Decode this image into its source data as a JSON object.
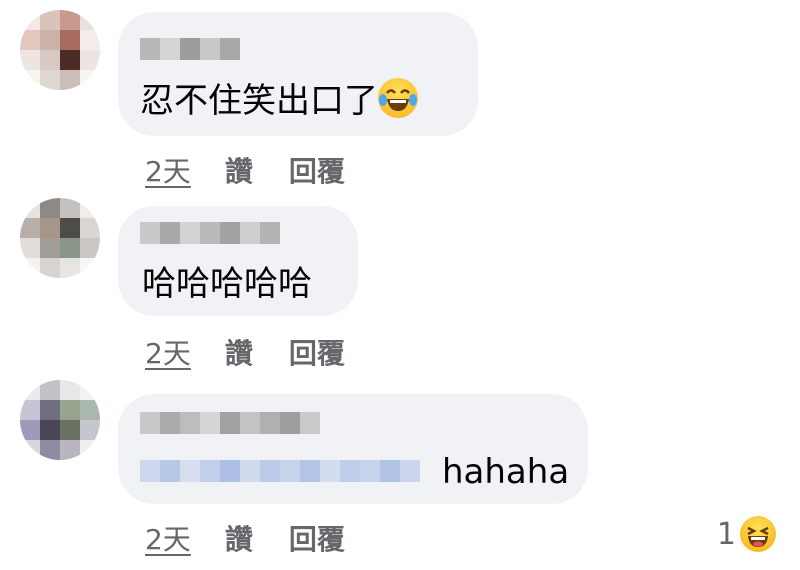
{
  "comments": [
    {
      "text": "忍不住笑出口了",
      "emoji_icon": "tears-of-joy-emoji",
      "time": "2天",
      "like": "讚",
      "reply": "回覆"
    },
    {
      "text": "哈哈哈哈哈",
      "time": "2天",
      "like": "讚",
      "reply": "回覆"
    },
    {
      "text": "hahaha",
      "time": "2天",
      "like": "讚",
      "reply": "回覆",
      "reaction_count": "1",
      "reaction_icon": "laughing-emoji"
    }
  ],
  "colors": {
    "bubble": "#f0f2f5",
    "action_text": "#65676b",
    "mention_blur": "#c9d6ef"
  }
}
